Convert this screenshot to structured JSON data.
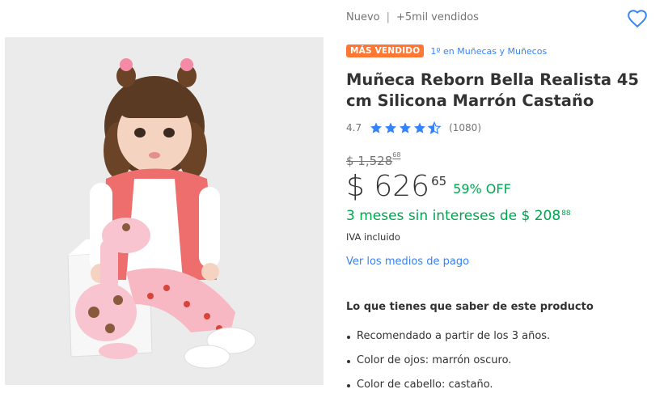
{
  "header": {
    "condition": "Nuevo",
    "separator": "|",
    "sold": "+5mil vendidos",
    "favorite_icon": "heart-outline-icon"
  },
  "badge": {
    "label": "MÁS VENDIDO",
    "rank": "1º en Muñecas y Muñecos",
    "color": "#ff7733"
  },
  "product": {
    "title": "Muñeca Reborn Bella Realista 45 cm Silicona Marrón Castaño",
    "rating": "4.7",
    "rating_value": 4.7,
    "reviews": "(1080)",
    "star_color": "#3483fa"
  },
  "pricing": {
    "old_price": "$ 1,528",
    "old_price_cents": "68",
    "price": "$ 626",
    "price_cents": "65",
    "discount": "59% OFF",
    "installments": "3 meses sin intereses de $ 208",
    "installments_cents": "88",
    "tax_note": "IVA incluido",
    "green": "#00a650"
  },
  "links": {
    "payment_methods": "Ver los medios de pago",
    "link_color": "#3483fa"
  },
  "details": {
    "heading": "Lo que tienes que saber de este producto",
    "features": [
      "Recomendado a partir de los 3 años.",
      "Color de ojos: marrón oscuro.",
      "Color de cabello: castaño."
    ]
  }
}
